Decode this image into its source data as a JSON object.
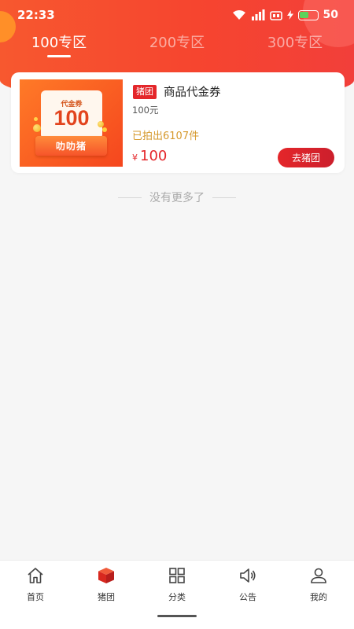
{
  "status_bar": {
    "time": "22:33",
    "battery": "50",
    "battery_fraction": 0.5
  },
  "tabs": [
    {
      "label": "100专区",
      "active": true
    },
    {
      "label": "200专区",
      "active": false
    },
    {
      "label": "300专区",
      "active": false
    }
  ],
  "product": {
    "tag": "猪团",
    "title": "商品代金券",
    "subtitle": "100元",
    "sold": "已拍出6107件",
    "currency": "¥",
    "price": "100",
    "button": "去猪团",
    "image": {
      "ticket_title": "代金券",
      "ticket_value": "100",
      "banner": "叻叻猪"
    }
  },
  "list_end": "没有更多了",
  "bottom_nav": [
    {
      "label": "首页",
      "icon": "home-icon"
    },
    {
      "label": "猪团",
      "icon": "box-icon",
      "active": true
    },
    {
      "label": "分类",
      "icon": "grid-icon"
    },
    {
      "label": "公告",
      "icon": "speaker-icon"
    },
    {
      "label": "我的",
      "icon": "user-icon"
    }
  ],
  "colors": {
    "accent": "#e4262a",
    "header": "#f6452f",
    "sold": "#d69a2e"
  }
}
